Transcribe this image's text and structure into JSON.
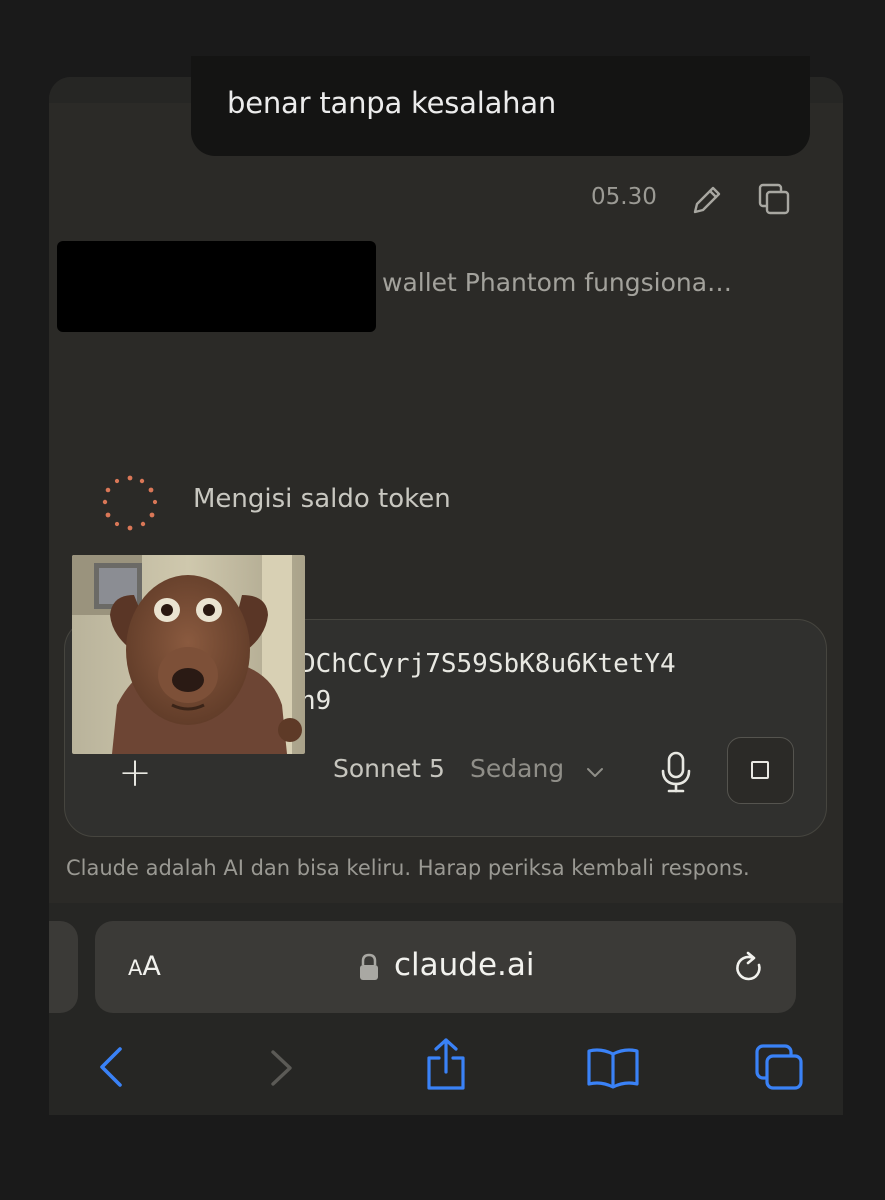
{
  "chat": {
    "user_message_tail": "benar tanpa kesalahan",
    "message_time": "05.30",
    "summary_line": "wallet Phantom fungsiona…",
    "status_text": "Mengisi saldo token"
  },
  "composer": {
    "input_line1": "DChCCyrj7S59SbK8u6KtetY4",
    "input_line2": "h9",
    "plus_label": "+",
    "model_name": "Sonnet 5",
    "model_level": "Sedang"
  },
  "disclaimer": "Claude adalah AI dan bisa keliru. Harap periksa kembali respons.",
  "browser": {
    "text_size_big": "A",
    "text_size_small": "A",
    "url": "claude.ai"
  },
  "icons": {
    "edit": "pencil-icon",
    "copy": "copy-icon",
    "spinner": "loading-spinner-icon",
    "mic": "microphone-icon",
    "stop": "stop-icon",
    "lock": "lock-icon",
    "reload": "reload-icon",
    "back": "chevron-left-icon",
    "forward": "chevron-right-icon",
    "share": "share-icon",
    "bookmarks": "book-icon",
    "tabs": "tabs-icon"
  },
  "colors": {
    "accent_blue": "#3a82f7",
    "spinner_orange": "#d97757",
    "panel_bg": "#2b2a27"
  }
}
